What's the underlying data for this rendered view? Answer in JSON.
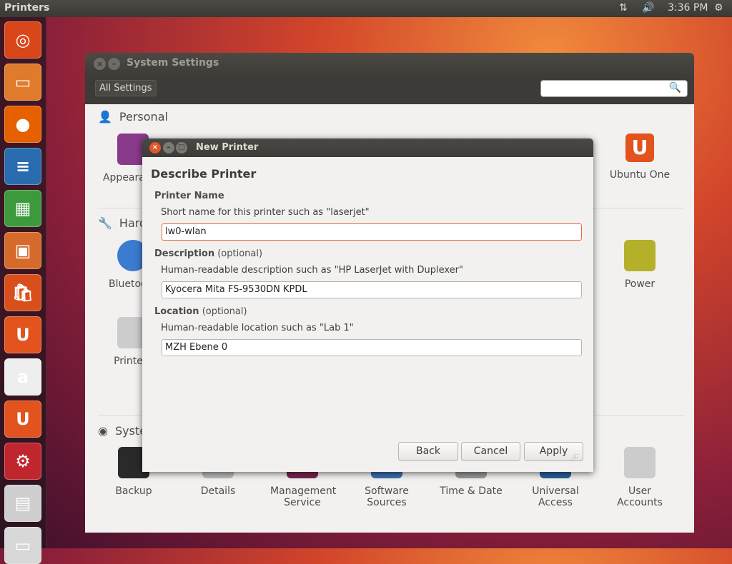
{
  "panel": {
    "app_title": "Printers",
    "time": "3:36 PM",
    "network_icon": "network-updown-icon",
    "volume_icon": "volume-icon",
    "gear_icon": "session-gear-icon"
  },
  "launcher": [
    {
      "name": "ubuntu-dash",
      "glyph": "◎",
      "color": "#d9461a"
    },
    {
      "name": "files",
      "glyph": "▭",
      "color": "#e07b2c"
    },
    {
      "name": "firefox",
      "glyph": "●",
      "color": "#e66000"
    },
    {
      "name": "writer",
      "glyph": "≡",
      "color": "#2a6cb0"
    },
    {
      "name": "calc",
      "glyph": "▦",
      "color": "#3c9a3c"
    },
    {
      "name": "impress",
      "glyph": "▣",
      "color": "#d66a2a"
    },
    {
      "name": "software-center",
      "glyph": "🛍",
      "color": "#d84f1c"
    },
    {
      "name": "ubuntu-one",
      "glyph": "U",
      "color": "#e2531d"
    },
    {
      "name": "amazon",
      "glyph": "a",
      "color": "#eeeeee"
    },
    {
      "name": "ubuntu-one-music",
      "glyph": "U",
      "color": "#e2531d"
    },
    {
      "name": "system-settings",
      "glyph": "⚙",
      "color": "#c0262d"
    },
    {
      "name": "printers",
      "glyph": "▤",
      "color": "#cfcfcf"
    },
    {
      "name": "extra",
      "glyph": "▭",
      "color": "#d8d8d8"
    }
  ],
  "settings": {
    "title": "System Settings",
    "all_settings": "All Settings",
    "search_placeholder": "",
    "sections": {
      "personal": "Personal",
      "hardware": "Hardware",
      "system": "System"
    },
    "personal_items": [
      "Appearance",
      "Ubuntu One"
    ],
    "hardware_items": [
      "Bluetooth",
      "Printers",
      "Power"
    ],
    "system_items": [
      "Backup",
      "Details",
      "Management Service",
      "Software Sources",
      "Time & Date",
      "Universal Access",
      "User Accounts"
    ]
  },
  "dialog": {
    "title": "New Printer",
    "heading": "Describe Printer",
    "printer_name": {
      "label": "Printer Name",
      "hint": "Short name for this printer such as \"laserjet\"",
      "value": "lw0-wlan"
    },
    "description": {
      "label": "Description",
      "optional": "(optional)",
      "hint": "Human-readable description such as \"HP LaserJet with Duplexer\"",
      "value": "Kyocera Mita FS-9530DN KPDL"
    },
    "location": {
      "label": "Location",
      "optional": "(optional)",
      "hint": "Human-readable location such as \"Lab 1\"",
      "value": "MZH Ebene 0"
    },
    "buttons": {
      "back": "Back",
      "cancel": "Cancel",
      "apply": "Apply"
    }
  }
}
